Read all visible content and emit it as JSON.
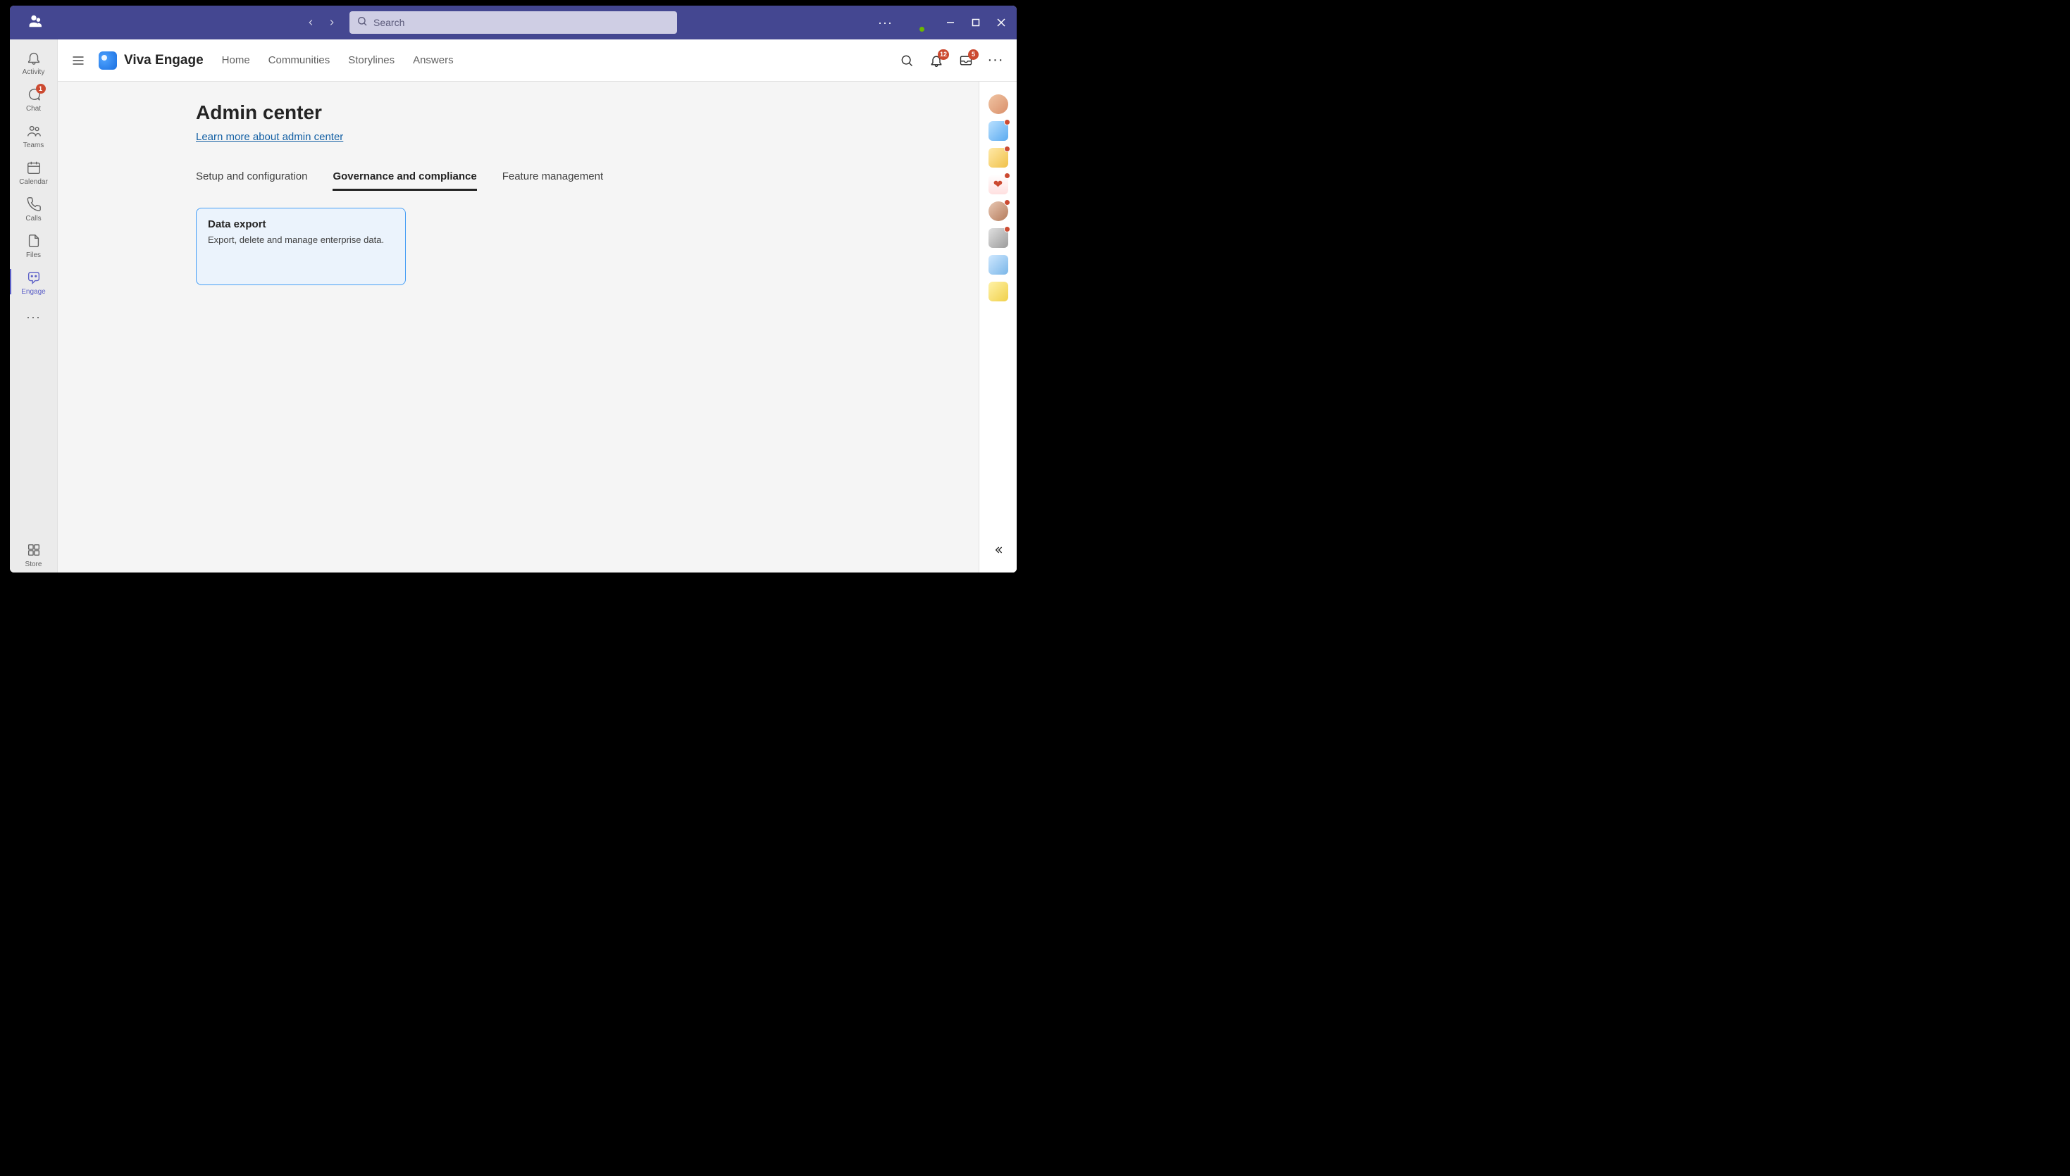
{
  "titlebar": {
    "search_placeholder": "Search"
  },
  "rail": {
    "items": [
      {
        "id": "activity",
        "label": "Activity",
        "badge": ""
      },
      {
        "id": "chat",
        "label": "Chat",
        "badge": "1"
      },
      {
        "id": "teams",
        "label": "Teams",
        "badge": ""
      },
      {
        "id": "calendar",
        "label": "Calendar",
        "badge": ""
      },
      {
        "id": "calls",
        "label": "Calls",
        "badge": ""
      },
      {
        "id": "files",
        "label": "Files",
        "badge": ""
      },
      {
        "id": "engage",
        "label": "Engage",
        "badge": "",
        "active": true
      }
    ],
    "store_label": "Store"
  },
  "engage_header": {
    "brand": "Viva Engage",
    "nav": [
      {
        "id": "home",
        "label": "Home"
      },
      {
        "id": "communities",
        "label": "Communities"
      },
      {
        "id": "storylines",
        "label": "Storylines"
      },
      {
        "id": "answers",
        "label": "Answers"
      }
    ],
    "notif_badge": "12",
    "inbox_badge": "5"
  },
  "page": {
    "title": "Admin center",
    "learn_link": "Learn more about admin center",
    "tabs": [
      {
        "id": "setup",
        "label": "Setup and configuration",
        "active": false
      },
      {
        "id": "gov",
        "label": "Governance and compliance",
        "active": true
      },
      {
        "id": "feat",
        "label": "Feature management",
        "active": false
      }
    ],
    "cards": [
      {
        "id": "data-export",
        "title": "Data export",
        "desc": "Export, delete and manage enterprise data."
      }
    ]
  },
  "people_rail": {
    "items": [
      {
        "id": "p0",
        "dot": false,
        "round": true
      },
      {
        "id": "p1",
        "dot": true
      },
      {
        "id": "p2",
        "dot": true
      },
      {
        "id": "p3",
        "dot": true,
        "heart": true
      },
      {
        "id": "p4",
        "dot": true,
        "round": true
      },
      {
        "id": "p5",
        "dot": true
      },
      {
        "id": "p6",
        "dot": false
      },
      {
        "id": "p7",
        "dot": false
      }
    ]
  }
}
